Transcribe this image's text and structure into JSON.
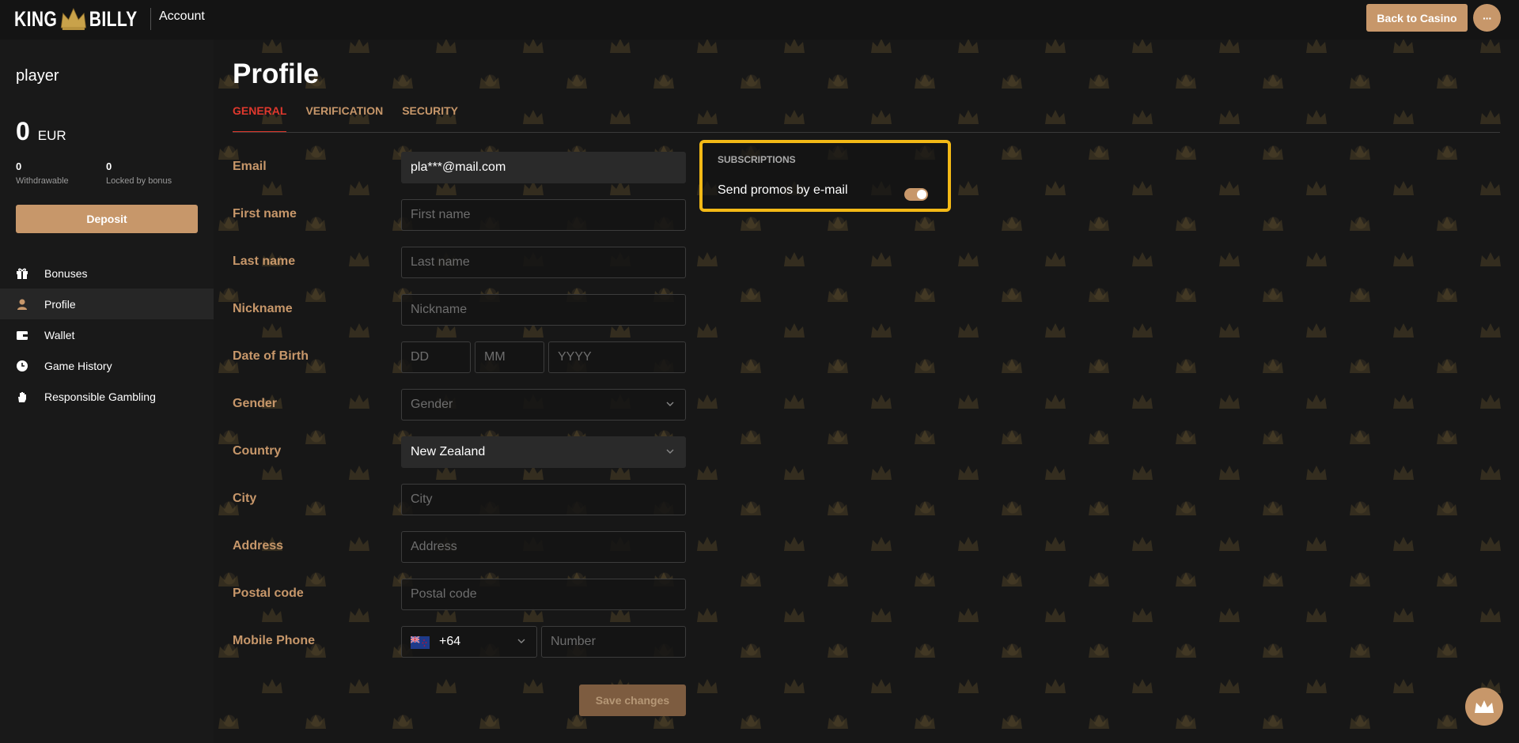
{
  "header": {
    "logo_left": "KING",
    "logo_right": "BILLY",
    "section_title": "Account",
    "back_label": "Back to Casino",
    "more_label": "···"
  },
  "sidebar": {
    "username": "player",
    "balance_amount": "0",
    "balance_currency": "EUR",
    "withdrawable_value": "0",
    "withdrawable_label": "Withdrawable",
    "locked_value": "0",
    "locked_label": "Locked by bonus",
    "deposit_label": "Deposit",
    "items": [
      {
        "label": "Bonuses",
        "icon": "gift-icon"
      },
      {
        "label": "Profile",
        "icon": "user-icon"
      },
      {
        "label": "Wallet",
        "icon": "wallet-icon"
      },
      {
        "label": "Game History",
        "icon": "clock-icon"
      },
      {
        "label": "Responsible Gambling",
        "icon": "hand-icon"
      }
    ]
  },
  "main": {
    "title": "Profile",
    "tabs": [
      {
        "label": "GENERAL"
      },
      {
        "label": "VERIFICATION"
      },
      {
        "label": "SECURITY"
      }
    ],
    "form": {
      "email_label": "Email",
      "email_value": "pla***@mail.com",
      "first_name_label": "First name",
      "first_name_placeholder": "First name",
      "last_name_label": "Last name",
      "last_name_placeholder": "Last name",
      "nickname_label": "Nickname",
      "nickname_placeholder": "Nickname",
      "dob_label": "Date of Birth",
      "dob_day_placeholder": "DD",
      "dob_month_placeholder": "MM",
      "dob_year_placeholder": "YYYY",
      "gender_label": "Gender",
      "gender_placeholder": "Gender",
      "country_label": "Country",
      "country_value": "New Zealand",
      "city_label": "City",
      "city_placeholder": "City",
      "address_label": "Address",
      "address_placeholder": "Address",
      "postal_label": "Postal code",
      "postal_placeholder": "Postal code",
      "phone_label": "Mobile Phone",
      "phone_code": "+64",
      "phone_placeholder": "Number",
      "save_label": "Save changes"
    },
    "subscriptions": {
      "title": "SUBSCRIPTIONS",
      "promo_label": "Send promos by e-mail",
      "promo_enabled": true
    }
  },
  "colors": {
    "accent": "#c7976a",
    "active_tab": "#e0382d",
    "highlight": "#f3b916",
    "background": "#141414"
  }
}
